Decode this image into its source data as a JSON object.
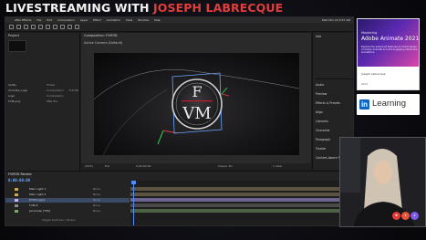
{
  "banner": {
    "text_white": "LIVESTREAMING WITH",
    "text_red": "JOSEPH LABRECQUE",
    "white_color": "#f2f2f2",
    "red_color": "#e23d3d"
  },
  "menubar": {
    "menus": [
      "After Effects",
      "File",
      "Edit",
      "Composition",
      "Layer",
      "Effect",
      "Animation",
      "View",
      "Window",
      "Help"
    ],
    "clock": "Wed Mar 24 8:57 AM"
  },
  "project": {
    "label": "Project",
    "items": [
      {
        "name": "Solids",
        "type": "Folder",
        "size": ""
      },
      {
        "name": "Animate_Logo",
        "type": "Composition",
        "size": "716 KB"
      },
      {
        "name": "Logo",
        "type": "Composition",
        "size": ""
      },
      {
        "name": "FVM.png",
        "type": "PNG file",
        "size": ""
      }
    ]
  },
  "viewer": {
    "tab": "Composition: FVM3D",
    "active_camera": "Active Camera (Default)",
    "zoom": "(50%)",
    "resolution": "Full",
    "time": "0:00:00:00",
    "renderer": "Classic 3D",
    "view": "1 View"
  },
  "logo": {
    "top_letter": "F",
    "bottom_letters": "VM",
    "accent": "#c21a2a"
  },
  "right_panel": {
    "info_header": "Info",
    "items": [
      "Audio",
      "Preview",
      "Effects & Presets",
      "Align",
      "Libraries",
      "Character",
      "Paragraph",
      "Tracker",
      "Content-Aware Fill"
    ]
  },
  "timeline": {
    "tab": "FVM3D Render",
    "timecode": "0:00:00:00",
    "layers": [
      {
        "num": "1",
        "name": "Main Light 1",
        "mode": "None",
        "color": "#d6a64a"
      },
      {
        "num": "2",
        "name": "Main Light 2",
        "mode": "None",
        "color": "#d6a64a"
      },
      {
        "num": "3",
        "name": "[FVM Logo]",
        "mode": "None",
        "color": "#c9b6f0"
      },
      {
        "num": "4",
        "name": "FVM-R",
        "mode": "None",
        "color": "#8a8a8a"
      },
      {
        "num": "5",
        "name": "[Animate_FVM]",
        "mode": "None",
        "color": "#7da86b"
      }
    ],
    "ruler_ticks": [
      "0s",
      "02s",
      "04s",
      "06s",
      "08s",
      "10s",
      "12s",
      "14s"
    ],
    "toggle_label": "Toggle Switches / Modes"
  },
  "book": {
    "series": "Mastering",
    "title": "Adobe Animate 2021",
    "subtitle": "Explore the advanced features and techniques of Adobe Animate to build engaging interactive animations",
    "author": "Joseph Labrecque",
    "publisher": "Packt"
  },
  "linkedin": {
    "logo": "in",
    "label": "Learning",
    "brand_color": "#0a66c2"
  },
  "reactions": {
    "colors": [
      "#e23d3d",
      "#e8553a",
      "#7b5ae8"
    ]
  }
}
